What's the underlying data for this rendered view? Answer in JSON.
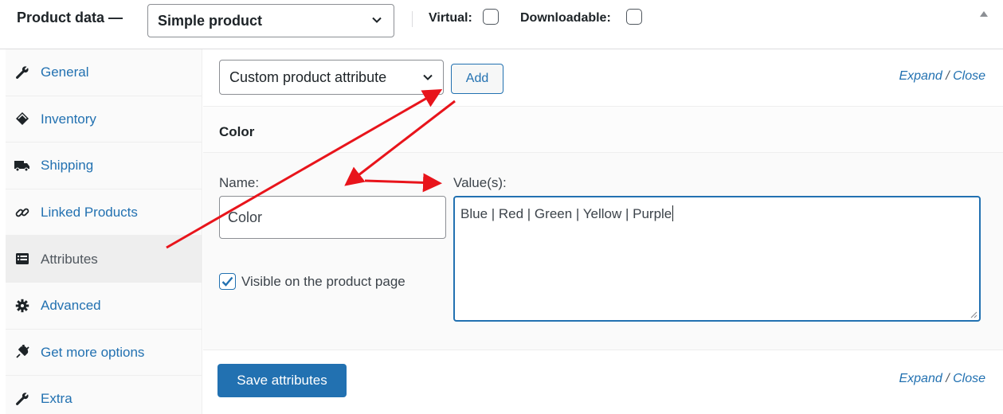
{
  "header": {
    "title": "Product data —",
    "product_type": "Simple product",
    "virtual_label": "Virtual:",
    "downloadable_label": "Downloadable:"
  },
  "sidebar": {
    "items": [
      {
        "label": "General",
        "icon": "wrench-icon"
      },
      {
        "label": "Inventory",
        "icon": "tag-icon"
      },
      {
        "label": "Shipping",
        "icon": "truck-icon"
      },
      {
        "label": "Linked Products",
        "icon": "link-icon"
      },
      {
        "label": "Attributes",
        "icon": "list-icon",
        "active": true
      },
      {
        "label": "Advanced",
        "icon": "gear-icon"
      },
      {
        "label": "Get more options",
        "icon": "plugin-icon"
      },
      {
        "label": "Extra",
        "icon": "wrench-icon"
      }
    ]
  },
  "toolbar": {
    "attribute_select": "Custom product attribute",
    "add_label": "Add",
    "expand_label": "Expand",
    "slash": " / ",
    "close_label": "Close"
  },
  "attribute": {
    "heading": "Color",
    "name_label": "Name:",
    "name_value": "Color",
    "values_label": "Value(s):",
    "values_value": "Blue | Red | Green | Yellow | Purple",
    "visible_label": "Visible on the product page",
    "visible_checked": true
  },
  "footer": {
    "save_label": "Save attributes",
    "expand_label": "Expand",
    "slash": " / ",
    "close_label": "Close"
  },
  "colors": {
    "accent": "#2271b1",
    "annotation_arrow": "#e8141b"
  }
}
